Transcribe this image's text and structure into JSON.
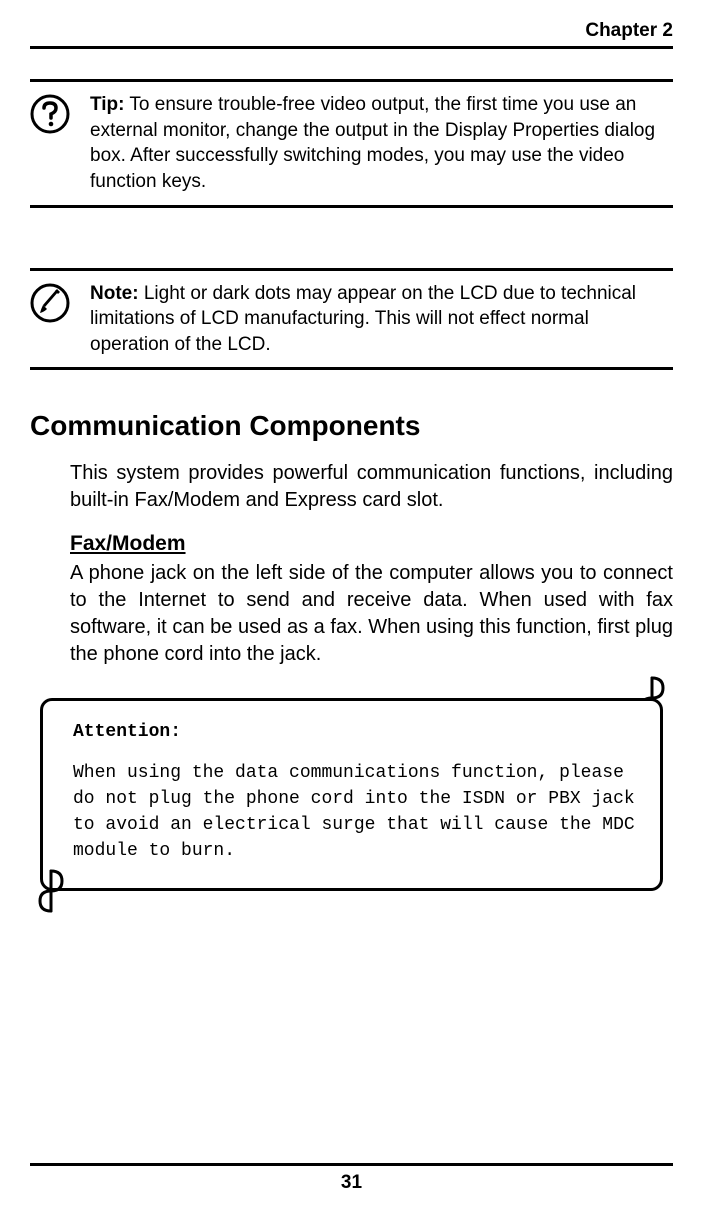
{
  "header": {
    "chapter": "Chapter 2"
  },
  "tip_box": {
    "label": "Tip:",
    "text": " To ensure trouble-free video output, the first time you use an external monitor, change the output in the Display Properties dialog box. After successfully switching modes, you may use the video function keys."
  },
  "note_box": {
    "label": "Note:",
    "text": " Light or dark dots may appear on the LCD due to technical limitations of LCD manufacturing. This will not effect normal operation of the LCD."
  },
  "section": {
    "heading": "Communication Components",
    "intro": "This system provides powerful communication functions, including built-in Fax/Modem and Express card slot.",
    "sub_heading": "Fax/Modem",
    "sub_body": "A phone jack on the left side of the computer allows you to connect to the Internet to send and receive data. When used with fax software, it can be used as a fax. When using this function, first plug the phone cord into the jack."
  },
  "attention": {
    "label": "Attention:",
    "text": "When using the data communications function, please do not plug the phone cord into the ISDN or PBX jack to avoid an electrical surge that will cause the MDC module to burn."
  },
  "footer": {
    "page": "31"
  }
}
